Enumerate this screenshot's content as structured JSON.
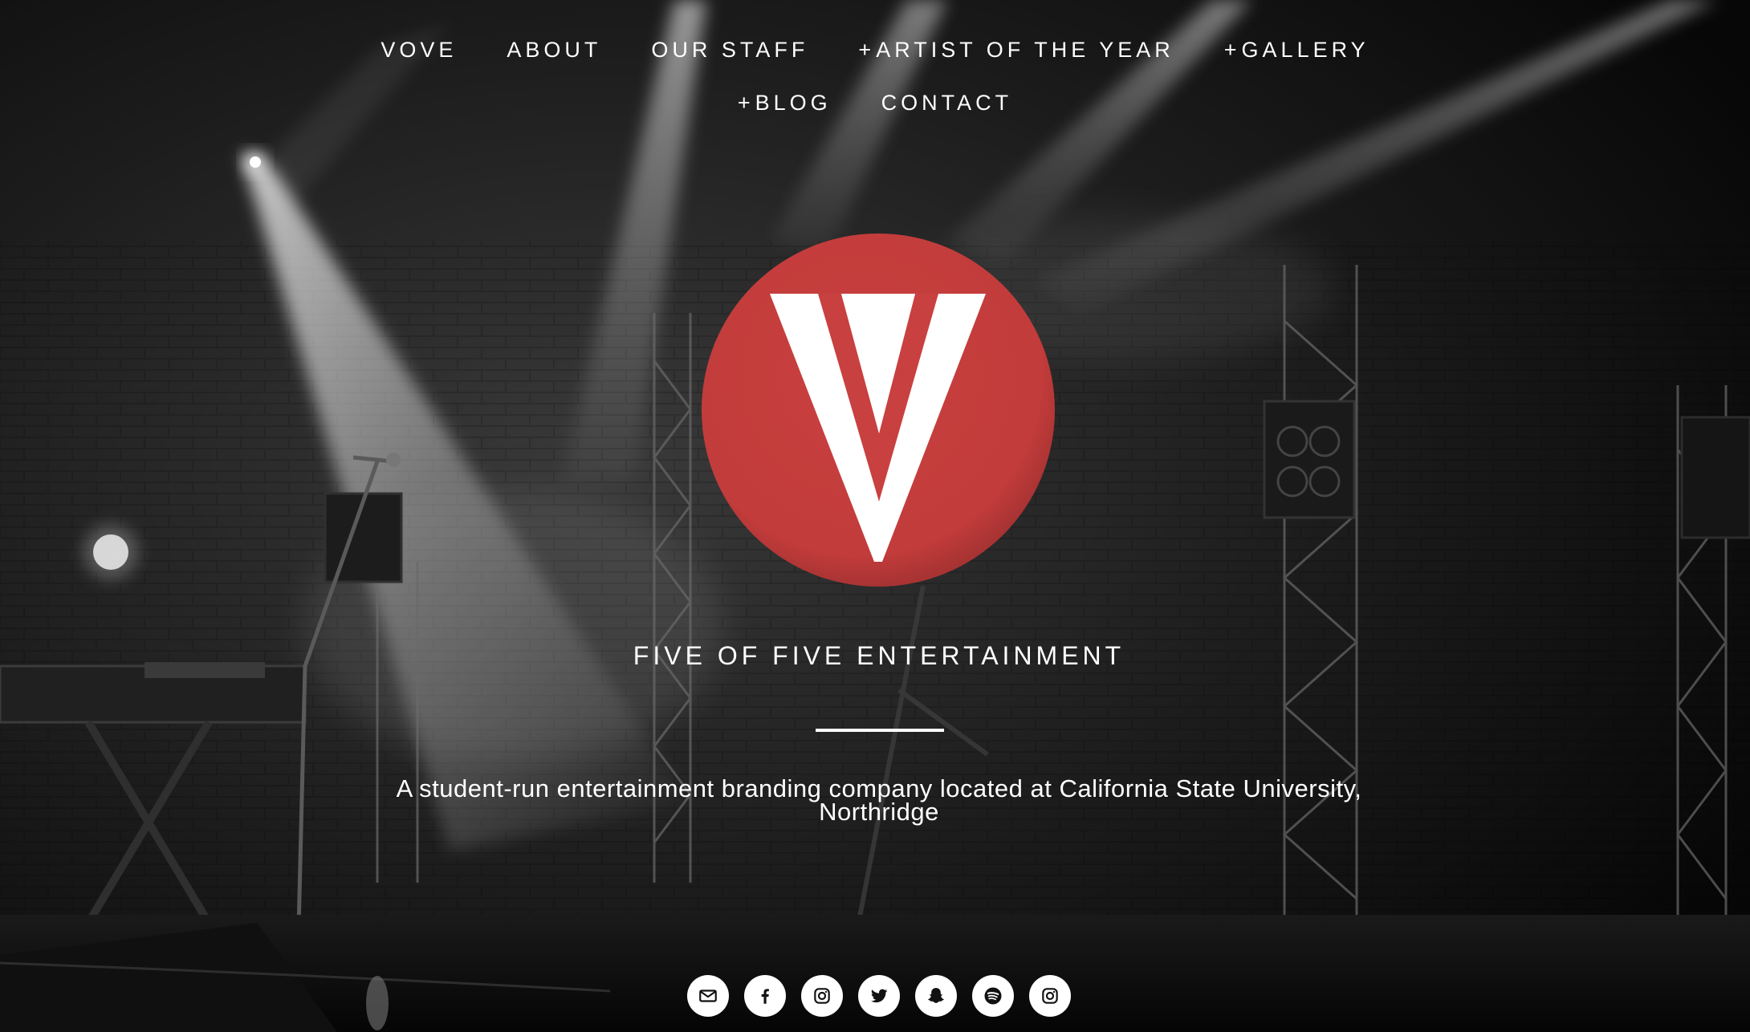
{
  "nav": {
    "row1": [
      {
        "label": "VOVE",
        "expandable": false
      },
      {
        "label": "ABOUT",
        "expandable": false
      },
      {
        "label": "OUR STAFF",
        "expandable": false
      },
      {
        "label": "ARTIST OF THE YEAR",
        "expandable": true
      },
      {
        "label": "GALLERY",
        "expandable": true
      }
    ],
    "row2": [
      {
        "label": "BLOG",
        "expandable": true
      },
      {
        "label": "CONTACT",
        "expandable": false
      }
    ],
    "expand_symbol": "+"
  },
  "hero": {
    "title": "FIVE OF FIVE ENTERTAINMENT",
    "tagline_line1": "A student-run entertainment branding company located at California State University,",
    "tagline_line2": "Northridge"
  },
  "social": [
    "mail-icon",
    "facebook-icon",
    "instagram-icon",
    "twitter-icon",
    "snapchat-icon",
    "spotify-icon",
    "instagram-icon"
  ],
  "colors": {
    "logo_red": "#c8403f",
    "background": "#0b0b0b",
    "text": "#ffffff"
  }
}
